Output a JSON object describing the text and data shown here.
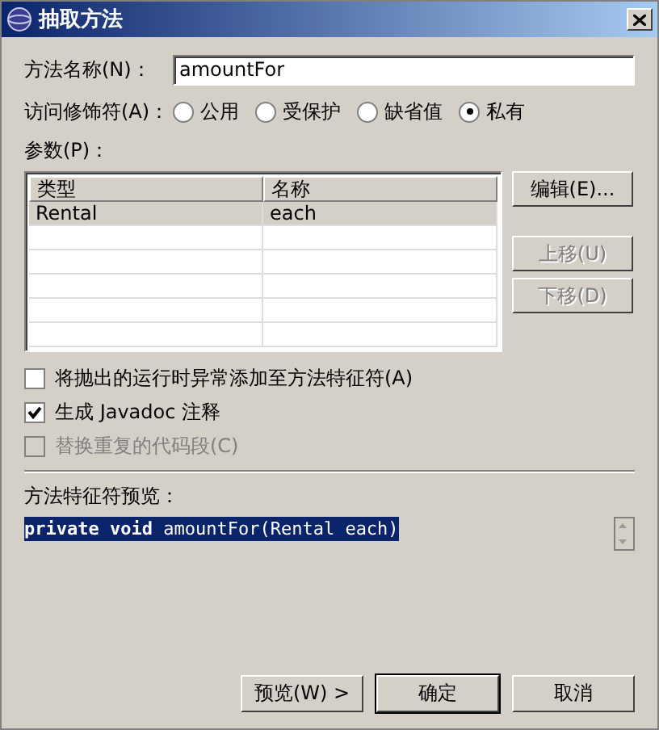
{
  "window": {
    "title": "抽取方法"
  },
  "method_name": {
    "label": "方法名称(N)：",
    "value": "amountFor"
  },
  "access": {
    "label": "访问修饰符(A)：",
    "options": [
      {
        "label": "公用",
        "selected": false
      },
      {
        "label": "受保护",
        "selected": false
      },
      {
        "label": "缺省值",
        "selected": false
      },
      {
        "label": "私有",
        "selected": true
      }
    ]
  },
  "parameters": {
    "label": "参数(P)：",
    "columns": [
      "类型",
      "名称"
    ],
    "rows": [
      {
        "cells": [
          "Rental",
          "each"
        ],
        "selected": true
      }
    ],
    "buttons": [
      {
        "label": "编辑(E)...",
        "disabled": false
      },
      {
        "label": "上移(U)",
        "disabled": true
      },
      {
        "label": "下移(D)",
        "disabled": true
      }
    ]
  },
  "options": [
    {
      "label": "将抛出的运行时异常添加至方法特征符(A)",
      "checked": false,
      "disabled": false
    },
    {
      "label": "生成 Javadoc 注释",
      "checked": true,
      "disabled": false
    },
    {
      "label": "替换重复的代码段(C)",
      "checked": false,
      "disabled": true
    }
  ],
  "preview": {
    "label": "方法特征符预览：",
    "text": "**private void** amountFor(Rental each)",
    "selected": true
  },
  "buttons": [
    {
      "label": "预览(W) >",
      "default": false
    },
    {
      "label": "确定",
      "default": true
    },
    {
      "label": "取消",
      "default": false
    }
  ]
}
